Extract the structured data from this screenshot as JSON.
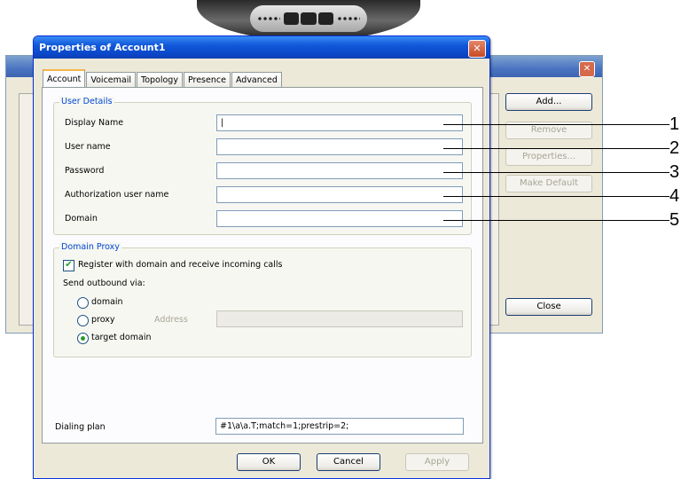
{
  "background_window": {
    "close_glyph": "✕",
    "buttons": {
      "add": "Add...",
      "remove": "Remove",
      "properties": "Properties...",
      "make_default": "Make Default",
      "close": "Close"
    }
  },
  "dialog": {
    "title": "Properties of Account1",
    "close_glyph": "✕",
    "tabs": [
      "Account",
      "Voicemail",
      "Topology",
      "Presence",
      "Advanced"
    ],
    "user_details": {
      "legend": "User Details",
      "fields": [
        {
          "label": "Display Name",
          "value": "|"
        },
        {
          "label": "User name",
          "value": ""
        },
        {
          "label": "Password",
          "value": ""
        },
        {
          "label": "Authorization user name",
          "value": ""
        },
        {
          "label": "Domain",
          "value": ""
        }
      ]
    },
    "domain_proxy": {
      "legend": "Domain Proxy",
      "register_label": "Register with domain and receive incoming calls",
      "register_checked": true,
      "send_outbound_label": "Send outbound via:",
      "options": {
        "domain": "domain",
        "proxy": "proxy",
        "target_domain": "target domain"
      },
      "selected": "target domain",
      "address_label": "Address",
      "address_value": ""
    },
    "dialing_plan": {
      "label": "Dialing plan",
      "value": "#1\\a\\a.T;match=1;prestrip=2;"
    },
    "buttons": {
      "ok": "OK",
      "cancel": "Cancel",
      "apply": "Apply"
    }
  },
  "callouts": [
    "1",
    "2",
    "3",
    "4",
    "5"
  ],
  "colors": {
    "title_bar": "#0a47c8",
    "dialog_bg": "#ece9d8",
    "legend_text": "#0046d5",
    "active_tab_accent": "#f5b64d"
  }
}
